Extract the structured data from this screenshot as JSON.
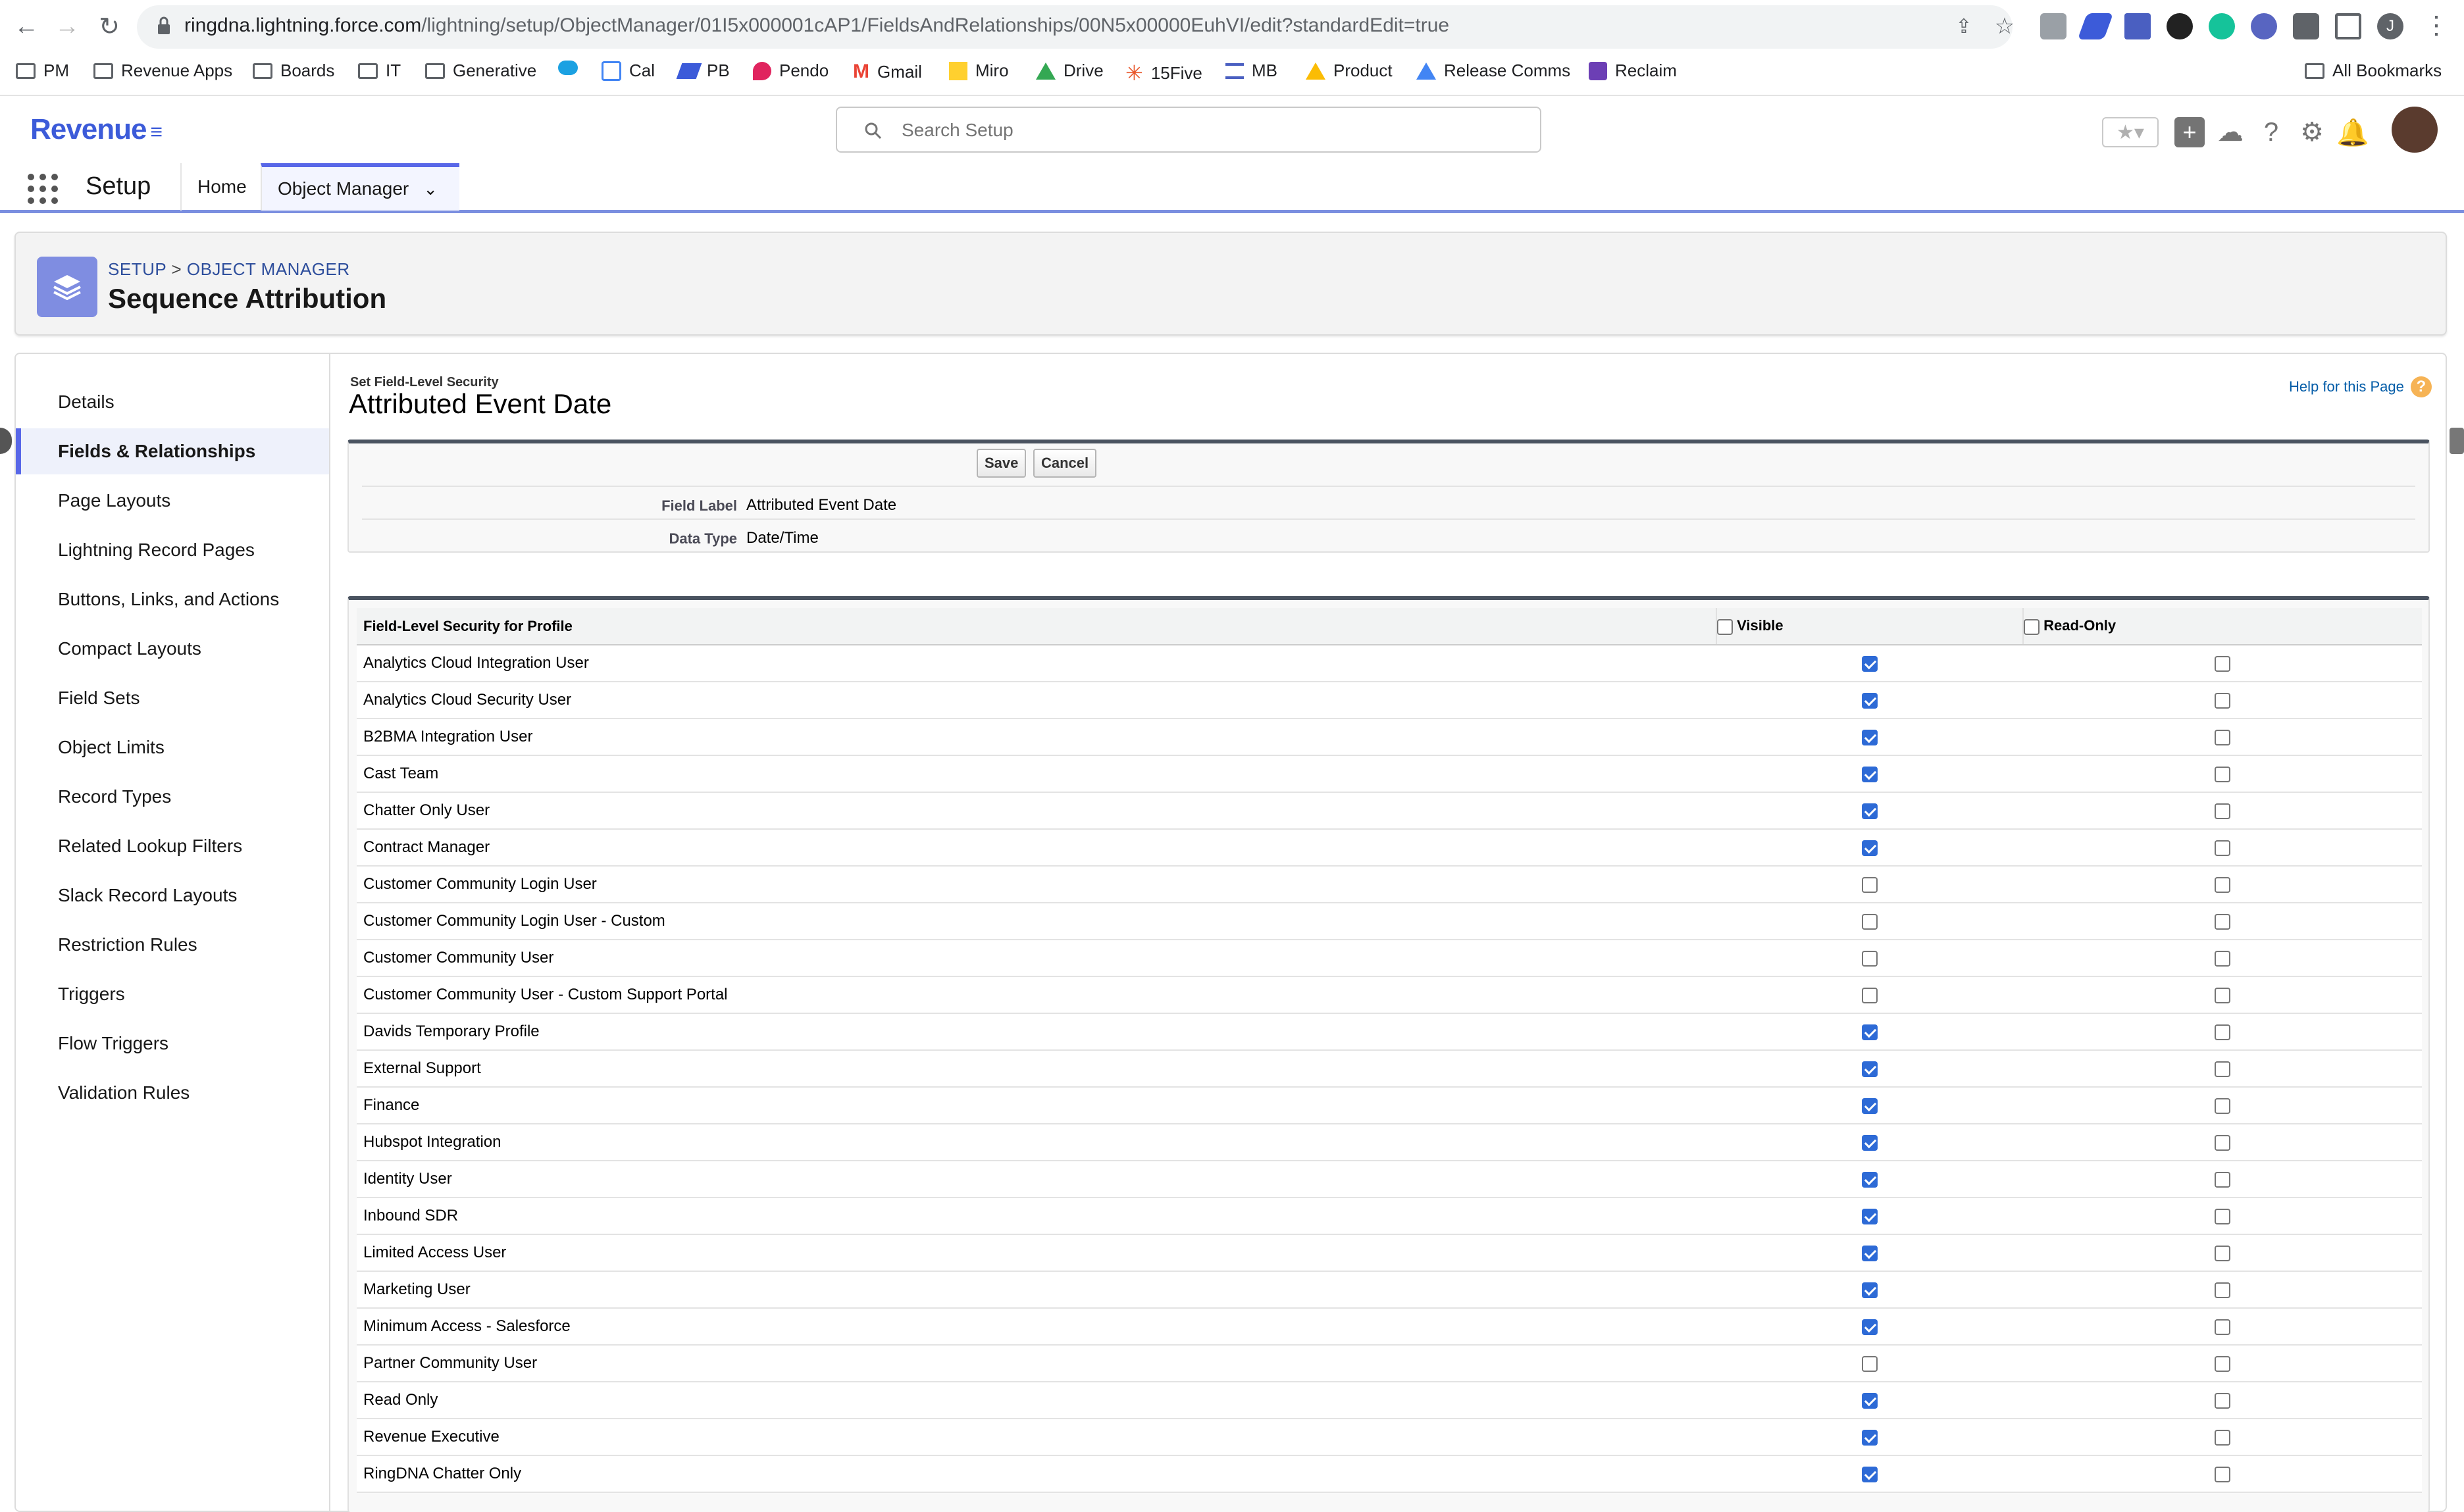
{
  "browser": {
    "url_host": "ringdna.lightning.force.com",
    "url_path": "/lightning/setup/ObjectManager/01I5x000001cAP1/FieldsAndRelationships/00N5x00000EuhVI/edit?standardEdit=true",
    "avatar_initial": "J",
    "bookmarks": [
      {
        "label": "PM",
        "icon": "folder-icon"
      },
      {
        "label": "Revenue Apps",
        "icon": "folder-icon"
      },
      {
        "label": "Boards",
        "icon": "folder-icon"
      },
      {
        "label": "IT",
        "icon": "folder-icon"
      },
      {
        "label": "Generative",
        "icon": "folder-icon"
      },
      {
        "label": "",
        "icon": "salesforce-cloud-icon"
      },
      {
        "label": "Cal",
        "icon": "calendar-icon"
      },
      {
        "label": "PB",
        "icon": "pb-icon"
      },
      {
        "label": "Pendo",
        "icon": "pendo-icon"
      },
      {
        "label": "Gmail",
        "icon": "gmail-icon"
      },
      {
        "label": "Miro",
        "icon": "miro-icon"
      },
      {
        "label": "Drive",
        "icon": "drive-icon"
      },
      {
        "label": "15Five",
        "icon": "15five-icon"
      },
      {
        "label": "MB",
        "icon": "mb-icon"
      },
      {
        "label": "Product",
        "icon": "drive-icon"
      },
      {
        "label": "Release Comms",
        "icon": "drive-icon"
      },
      {
        "label": "Reclaim",
        "icon": "reclaim-icon"
      }
    ],
    "all_bookmarks": "All Bookmarks"
  },
  "header": {
    "logo": "Revenue",
    "search_placeholder": "Search Setup"
  },
  "appnav": {
    "app_name": "Setup",
    "tabs": [
      "Home",
      "Object Manager"
    ]
  },
  "page_header": {
    "breadcrumb_setup": "SETUP",
    "breadcrumb_sep": " > ",
    "breadcrumb_om": "OBJECT MANAGER",
    "title": "Sequence Attribution"
  },
  "sidebar": {
    "items": [
      "Details",
      "Fields & Relationships",
      "Page Layouts",
      "Lightning Record Pages",
      "Buttons, Links, and Actions",
      "Compact Layouts",
      "Field Sets",
      "Object Limits",
      "Record Types",
      "Related Lookup Filters",
      "Slack Record Layouts",
      "Restriction Rules",
      "Triggers",
      "Flow Triggers",
      "Validation Rules"
    ],
    "active_index": 1
  },
  "content": {
    "section_label": "Set Field-Level Security",
    "field_title": "Attributed Event Date",
    "help_link": "Help for this Page",
    "save_label": "Save",
    "cancel_label": "Cancel",
    "field_label_label": "Field Label",
    "field_label_value": "Attributed Event Date",
    "data_type_label": "Data Type",
    "data_type_value": "Date/Time"
  },
  "table": {
    "headers": [
      "Field-Level Security for Profile",
      "Visible",
      "Read-Only"
    ],
    "header_visible_checked": false,
    "header_readonly_checked": false,
    "rows": [
      {
        "profile": "Analytics Cloud Integration User",
        "visible": true,
        "readonly": false
      },
      {
        "profile": "Analytics Cloud Security User",
        "visible": true,
        "readonly": false
      },
      {
        "profile": "B2BMA Integration User",
        "visible": true,
        "readonly": false
      },
      {
        "profile": "Cast Team",
        "visible": true,
        "readonly": false
      },
      {
        "profile": "Chatter Only User",
        "visible": true,
        "readonly": false
      },
      {
        "profile": "Contract Manager",
        "visible": true,
        "readonly": false
      },
      {
        "profile": "Customer Community Login User",
        "visible": false,
        "readonly": false
      },
      {
        "profile": "Customer Community Login User - Custom",
        "visible": false,
        "readonly": false
      },
      {
        "profile": "Customer Community User",
        "visible": false,
        "readonly": false
      },
      {
        "profile": "Customer Community User - Custom Support Portal",
        "visible": false,
        "readonly": false
      },
      {
        "profile": "Davids Temporary Profile",
        "visible": true,
        "readonly": false
      },
      {
        "profile": "External Support",
        "visible": true,
        "readonly": false
      },
      {
        "profile": "Finance",
        "visible": true,
        "readonly": false
      },
      {
        "profile": "Hubspot Integration",
        "visible": true,
        "readonly": false
      },
      {
        "profile": "Identity User",
        "visible": true,
        "readonly": false
      },
      {
        "profile": "Inbound SDR",
        "visible": true,
        "readonly": false
      },
      {
        "profile": "Limited Access User",
        "visible": true,
        "readonly": false
      },
      {
        "profile": "Marketing User",
        "visible": true,
        "readonly": false
      },
      {
        "profile": "Minimum Access - Salesforce",
        "visible": true,
        "readonly": false
      },
      {
        "profile": "Partner Community User",
        "visible": false,
        "readonly": false
      },
      {
        "profile": "Read Only",
        "visible": true,
        "readonly": false
      },
      {
        "profile": "Revenue Executive",
        "visible": true,
        "readonly": false
      },
      {
        "profile": "RingDNA Chatter Only",
        "visible": true,
        "readonly": false
      }
    ]
  },
  "colors": {
    "brand": "#3c5bd9",
    "accent": "#5867e8",
    "checkbox_on": "#2d6ad6"
  }
}
